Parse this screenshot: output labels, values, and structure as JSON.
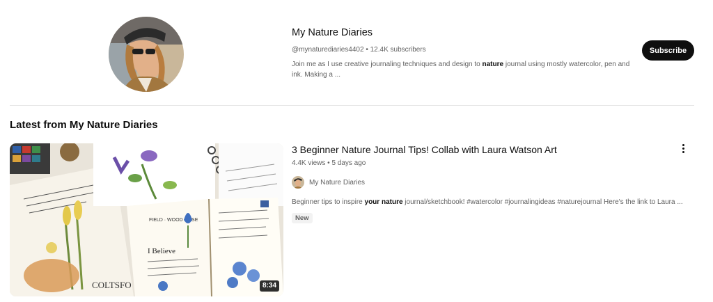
{
  "channel": {
    "name": "My Nature Diaries",
    "handle": "@mynaturediaries4402",
    "separator": "•",
    "subscribers": "12.4K subscribers",
    "description_before": "Join me as I use creative journaling techniques and design to ",
    "description_bold": "nature",
    "description_after": " journal using mostly watercolor, pen and ink. Making a ...",
    "subscribe_label": "Subscribe",
    "avatar_icon": "person-photo-icon"
  },
  "section": {
    "title": "Latest from My Nature Diaries"
  },
  "video": {
    "title": "3 Beginner Nature Journal Tips! Collab with Laura Watson Art",
    "views": "4.4K views",
    "separator": "•",
    "age": "5 days ago",
    "channel_name": "My Nature Diaries",
    "description_before": "Beginner tips to inspire ",
    "description_bold": "your nature",
    "description_after": " journal/sketchbook! #watercolor #journalingideas #naturejournal Here's the link to Laura ...",
    "badge": "New",
    "duration": "8:34",
    "thumbnail_icon": "nature-journal-thumbnail",
    "menu_icon": "more-vert-icon"
  },
  "colors": {
    "text_primary": "#0f0f0f",
    "text_secondary": "#606060",
    "subscribe_bg": "#0f0f0f",
    "badge_bg": "#f2f2f2"
  }
}
